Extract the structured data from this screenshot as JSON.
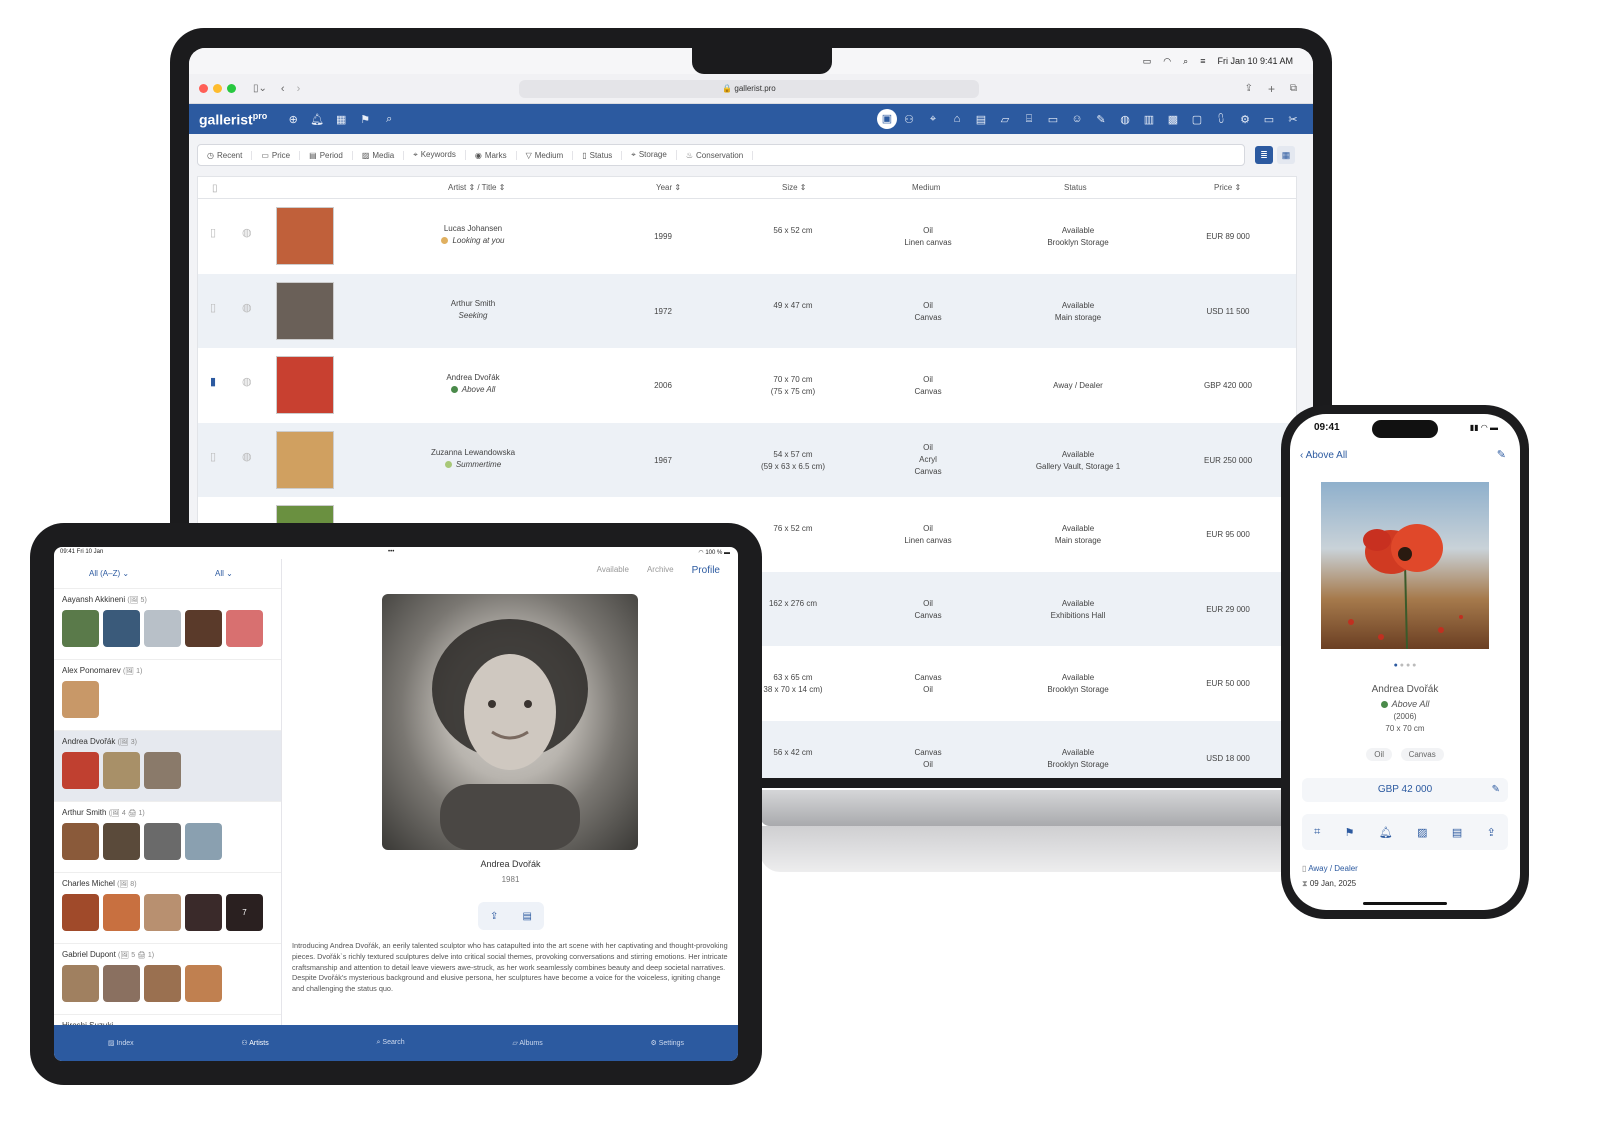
{
  "laptop": {
    "menubar": {
      "datetime": "Fri Jan 10 9:41 AM"
    },
    "browser": {
      "url": "gallerist.pro"
    },
    "app": {
      "logo": "gallerist",
      "logo_sup": "pro"
    },
    "filters": [
      "Recent",
      "Price",
      "Period",
      "Media",
      "Keywords",
      "Marks",
      "Medium",
      "Status",
      "Storage",
      "Conservation"
    ],
    "columns": {
      "artist_title": "Artist ⇕ / Title ⇕",
      "year": "Year ⇕",
      "size": "Size ⇕",
      "medium": "Medium",
      "status": "Status",
      "price": "Price ⇕"
    },
    "rows": [
      {
        "artist": "Lucas Johansen",
        "title": "Looking at you",
        "dot": "#e0b060",
        "year": "1999",
        "size": "56 x 52 cm",
        "size2": "",
        "medium": "Oil",
        "medium2": "Linen canvas",
        "medium3": "",
        "status": "Available",
        "status2": "Brooklyn Storage",
        "price": "EUR 89 000",
        "bookmarked": false
      },
      {
        "artist": "Arthur Smith",
        "title": "Seeking",
        "dot": "",
        "year": "1972",
        "size": "49 x 47 cm",
        "size2": "",
        "medium": "Oil",
        "medium2": "Canvas",
        "medium3": "",
        "status": "Available",
        "status2": "Main storage",
        "price": "USD 11 500",
        "bookmarked": false
      },
      {
        "artist": "Andrea Dvořák",
        "title": "Above All",
        "dot": "#4a8a4a",
        "year": "2006",
        "size": "70 x 70 cm",
        "size2": "(75 x 75 cm)",
        "medium": "Oil",
        "medium2": "Canvas",
        "medium3": "",
        "status": "Away / Dealer",
        "status2": "",
        "price": "GBP 420 000",
        "bookmarked": true
      },
      {
        "artist": "Zuzanna Lewandowska",
        "title": "Summertime",
        "dot": "#a8c878",
        "year": "1967",
        "size": "54 x 57 cm",
        "size2": "(59 x 63 x 6.5 cm)",
        "medium": "Oil",
        "medium2": "Acryl",
        "medium3": "Canvas",
        "status": "Available",
        "status2": "Gallery Vault, Storage 1",
        "price": "EUR 250 000",
        "bookmarked": false
      },
      {
        "artist": "",
        "title": "",
        "dot": "",
        "year": "",
        "size": "76 x 52 cm",
        "size2": "",
        "medium": "Oil",
        "medium2": "Linen canvas",
        "medium3": "",
        "status": "Available",
        "status2": "Main storage",
        "price": "EUR 95 000",
        "bookmarked": false
      },
      {
        "artist": "",
        "title": "",
        "dot": "",
        "year": "",
        "size": "162 x 276 cm",
        "size2": "",
        "medium": "Oil",
        "medium2": "Canvas",
        "medium3": "",
        "status": "Available",
        "status2": "Exhibitions Hall",
        "price": "EUR 29 000",
        "bookmarked": false
      },
      {
        "artist": "",
        "title": "",
        "dot": "",
        "year": "",
        "size": "63 x 65 cm",
        "size2": "38 x 70 x 14 cm)",
        "medium": "Canvas",
        "medium2": "Oil",
        "medium3": "",
        "status": "Available",
        "status2": "Brooklyn Storage",
        "price": "EUR 50 000",
        "bookmarked": false
      },
      {
        "artist": "",
        "title": "",
        "dot": "",
        "year": "",
        "size": "56 x 42 cm",
        "size2": "",
        "medium": "Canvas",
        "medium2": "Oil",
        "medium3": "",
        "status": "Available",
        "status2": "Brooklyn Storage",
        "price": "USD 18 000",
        "bookmarked": false
      }
    ]
  },
  "tablet": {
    "status": {
      "time": "09:41  Fri 10 Jan",
      "battery": "100 %"
    },
    "filter_sort": "All (A–Z) ⌄",
    "filter_all": "All ⌄",
    "tabs": {
      "available": "Available",
      "archive": "Archive",
      "profile": "Profile"
    },
    "artists": [
      {
        "name": "Aayansh Akkineni",
        "count": "(🖼 5)",
        "thumbs": [
          "#5a7a4a",
          "#3a5a7a",
          "#b8c0c8",
          "#5a3a2a",
          "#d87070"
        ],
        "selected": false
      },
      {
        "name": "Alex Ponomarev",
        "count": "(🖼 1)",
        "thumbs": [
          "#c89868"
        ],
        "selected": false
      },
      {
        "name": "Andrea Dvořák",
        "count": "(🖼 3)",
        "thumbs": [
          "#c04030",
          "#a89068",
          "#8a7a6a"
        ],
        "selected": true
      },
      {
        "name": "Arthur Smith",
        "count": "(🖼 4  🖨 1)",
        "thumbs": [
          "#8a5a3a",
          "#5a4a3a",
          "#6a6a6a",
          "#8aa0b0"
        ],
        "selected": false
      },
      {
        "name": "Charles Michel",
        "count": "(🖼 8)",
        "thumbs": [
          "#a04a2a",
          "#c87040",
          "#b89070",
          "#3a2a2a",
          "#2a2020"
        ],
        "selected": false
      },
      {
        "name": "Gabriel Dupont",
        "count": "(🖼 5  🖨 1)",
        "thumbs": [
          "#a08060",
          "#8a7060",
          "#9a7050",
          "#c08050"
        ],
        "selected": false
      },
      {
        "name": "Hiroshi Suzuki",
        "count": "",
        "thumbs": [],
        "selected": false
      }
    ],
    "thumb_badge": "7",
    "profile": {
      "name": "Andrea Dvořák",
      "year": "1981",
      "bio": "Introducing Andrea Dvořák, an eerily talented sculptor who has catapulted into the art scene with her captivating and thought-provoking pieces. Dvořák`s richly textured sculptures delve into critical social themes, provoking conversations and stirring emotions. Her intricate craftsmanship and attention to detail leave viewers awe-struck, as her work seamlessly combines beauty and deep societal narratives. Despite Dvořák's mysterious background and elusive persona, her sculptures have become a voice for the voiceless, igniting change and challenging the status quo."
    },
    "tabbar": [
      "Index",
      "Artists",
      "Search",
      "Albums",
      "Settings"
    ]
  },
  "phone": {
    "time": "09:41",
    "back": "Above All",
    "artist": "Andrea Dvořák",
    "title": "Above All",
    "year": "(2006)",
    "size": "70 x 70 cm",
    "chips": [
      "Oil",
      "Canvas"
    ],
    "price": "GBP 42 000",
    "status": "Away / Dealer",
    "date": "09 Jan, 2025"
  }
}
